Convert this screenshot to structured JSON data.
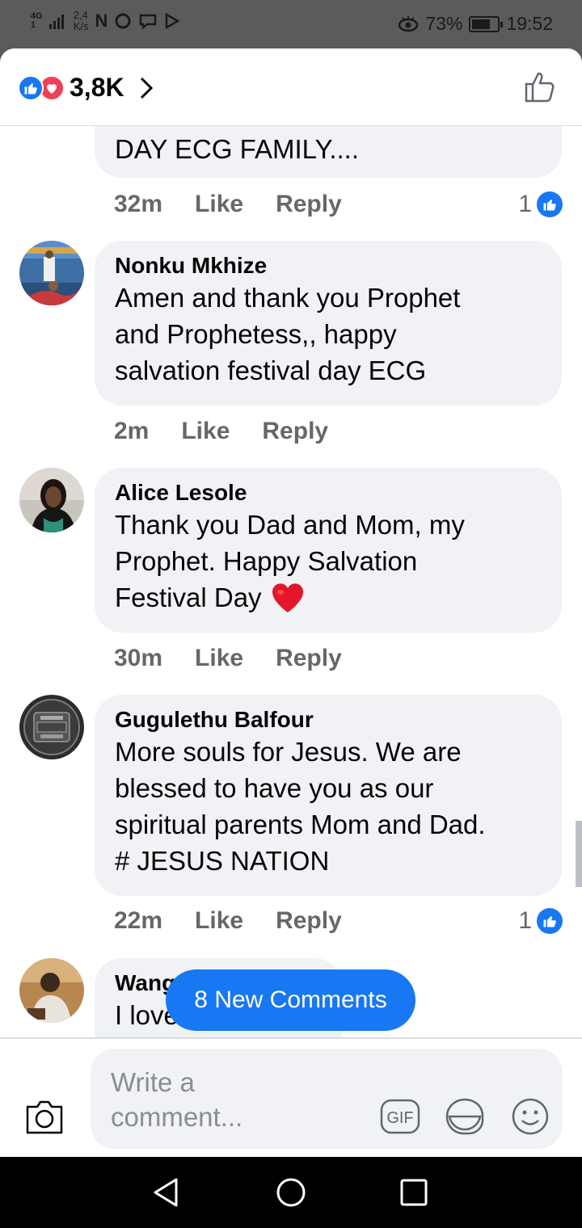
{
  "status_bar": {
    "network_top": "4G",
    "network_bottom": "1",
    "speed_value": "2,4",
    "speed_unit": "K/s",
    "icons": [
      "n-icon",
      "o-icon",
      "chat-icon",
      "play-icon"
    ],
    "battery": "73%",
    "battery_level": 0.73,
    "time": "19:52"
  },
  "header": {
    "reaction_count": "3,8K",
    "reaction_icons": [
      "like-reaction-icon",
      "love-reaction-icon"
    ]
  },
  "comments": [
    {
      "text": "DAY ECG FAMILY....",
      "time": "32m",
      "like_label": "Like",
      "reply_label": "Reply",
      "likes": "1"
    },
    {
      "author": "Nonku Mkhize",
      "text_lines": [
        "Amen and thank you Prophet",
        "and Prophetess,, happy",
        "salvation festival day ECG"
      ],
      "time": "2m",
      "like_label": "Like",
      "reply_label": "Reply"
    },
    {
      "author": "Alice Lesole",
      "text_lines": [
        "Thank you Dad and Mom, my",
        "Prophet. Happy Salvation",
        "Festival Day"
      ],
      "emoji": "heart",
      "time": "30m",
      "like_label": "Like",
      "reply_label": "Reply"
    },
    {
      "author": "Gugulethu Balfour",
      "text_lines": [
        "More souls for Jesus. We are",
        "blessed to have you as our",
        "spiritual parents Mom and Dad.",
        "# JESUS NATION"
      ],
      "time": "22m",
      "like_label": "Like",
      "reply_label": "Reply",
      "likes": "1"
    },
    {
      "author": "Wang",
      "text": "I love this"
    }
  ],
  "new_comments_button": "8 New Comments",
  "composer": {
    "placeholder_line1": "Write a",
    "placeholder_line2": "comment...",
    "gif_label": "GIF"
  },
  "colors": {
    "accent": "#1877f2",
    "love": "#f33e58",
    "bubble": "#f0f2f5",
    "secondary_text": "#65676b"
  }
}
